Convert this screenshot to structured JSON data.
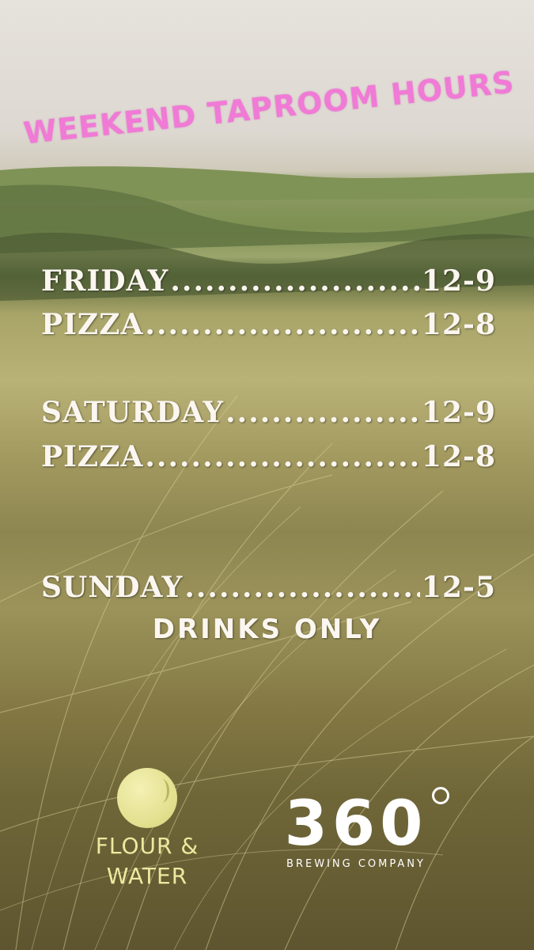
{
  "title": "WEEKEND TAPROOM HOURS",
  "schedule": [
    {
      "day": "FRIDAY",
      "hours": "12-9"
    },
    {
      "day": "PIZZA",
      "hours": "12-8"
    },
    {
      "day": "SATURDAY",
      "hours": "12-9"
    },
    {
      "day": "PIZZA",
      "hours": "12-8"
    },
    {
      "day": "SUNDAY",
      "hours": "12-5"
    }
  ],
  "sunday_note": "DRINKS ONLY",
  "logos": {
    "flour_water": {
      "line1": "FLOUR &",
      "line2": "WATER"
    },
    "brewery": {
      "number": "360",
      "sub": "BREWING COMPANY"
    }
  },
  "colors": {
    "title": "#f07ad6",
    "text": "#fbf6ef",
    "flour_water": "#ecea9f"
  }
}
